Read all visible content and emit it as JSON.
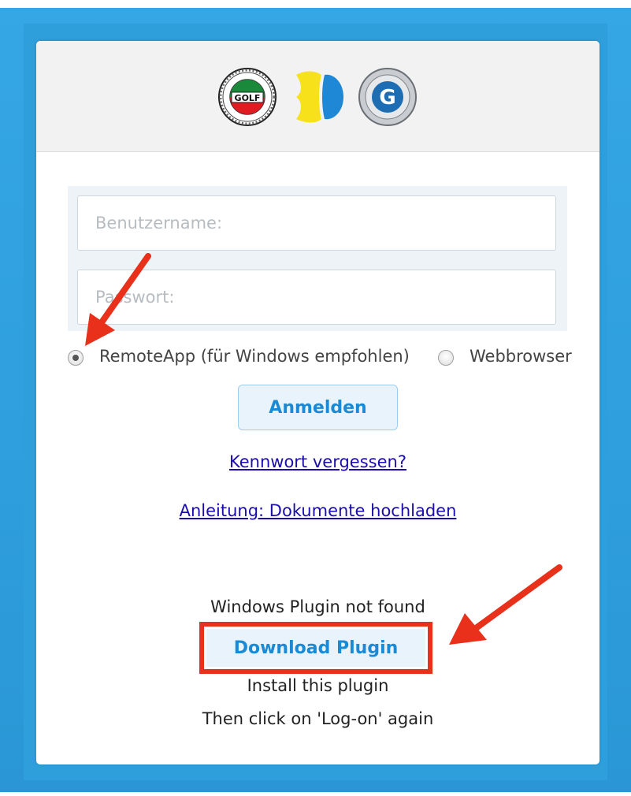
{
  "header": {
    "logos": [
      {
        "name": "regional-golf-association-seal",
        "text": "GOLF"
      },
      {
        "name": "yellow-blue-leaf-logo",
        "text": ""
      },
      {
        "name": "german-golf-association-seal",
        "text": "G"
      }
    ]
  },
  "login": {
    "username_placeholder": "Benutzername:",
    "password_placeholder": "Passwort:",
    "username_value": "",
    "password_value": ""
  },
  "mode": {
    "remoteapp_label": "RemoteApp (für Windows empfohlen)",
    "webbrowser_label": "Webbrowser",
    "selected": "remoteapp"
  },
  "buttons": {
    "login_label": "Anmelden",
    "download_label": "Download Plugin"
  },
  "links": {
    "forgot_password": "Kennwort vergessen?",
    "upload_guide": "Anleitung: Dokumente hochladen"
  },
  "plugin": {
    "status": "Windows Plugin not found",
    "install_hint": "Install this plugin",
    "logon_hint": "Then click on 'Log-on' again"
  },
  "colors": {
    "frame_blue": "#2f9fdc",
    "button_text_blue": "#1a8ad4",
    "highlight_red": "#e8301b",
    "link_color": "#1a0dab"
  }
}
